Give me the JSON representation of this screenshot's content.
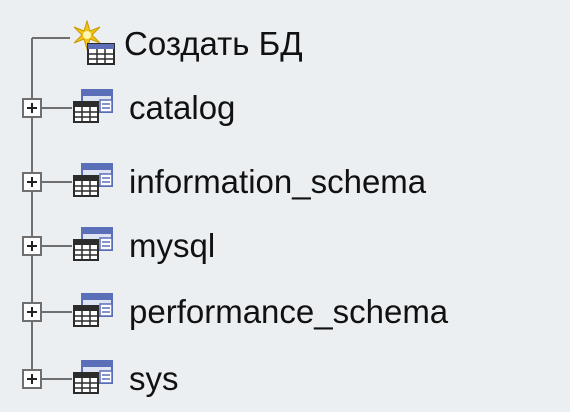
{
  "tree": {
    "create_label": "Создать БД",
    "create_icon": "new-database-icon",
    "expander_icon": "plus-box-icon",
    "database_icon": "database-table-icon",
    "databases": [
      {
        "label": "catalog"
      },
      {
        "label": "information_schema"
      },
      {
        "label": "mysql"
      },
      {
        "label": "performance_schema"
      },
      {
        "label": "sys"
      }
    ]
  },
  "colors": {
    "panel_background": "#eceff1",
    "text": "#111111",
    "tree_lines": "#6f6f6f",
    "icon_blue": "#5a6fb8",
    "icon_star": "#f2c21b"
  }
}
